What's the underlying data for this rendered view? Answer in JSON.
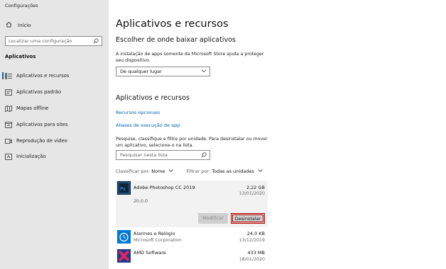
{
  "window": {
    "title": "Configurações"
  },
  "sidebar": {
    "home_label": "Início",
    "search_placeholder": "Localizar uma configuração",
    "section_label": "Aplicativos",
    "items": [
      {
        "label": "Aplicativos e recursos",
        "icon": "list-icon",
        "active": true
      },
      {
        "label": "Aplicativos padrão",
        "icon": "default-apps-icon"
      },
      {
        "label": "Mapas offline",
        "icon": "map-icon"
      },
      {
        "label": "Aplicativos para sites",
        "icon": "web-app-icon"
      },
      {
        "label": "Reprodução de vídeo",
        "icon": "video-icon"
      },
      {
        "label": "Inicialização",
        "icon": "startup-icon"
      }
    ]
  },
  "main": {
    "title": "Aplicativos e recursos",
    "install_section": {
      "heading": "Escolher de onde baixar aplicativos",
      "description": "A instalação de apps somente da Microsoft Store ajuda a proteger seu dispositivo.",
      "dropdown_value": "De qualquer lugar"
    },
    "apps_section": {
      "heading": "Aplicativos e recursos",
      "link_optional": "Recursos opcionais",
      "link_aliases": "Aliases de execução de app",
      "description": "Pesquise, classifique e filtre por unidade. Para desinstalar ou mover um aplicativo, selecione-o na lista.",
      "search_placeholder": "Pesquisar nesta lista",
      "sort_label": "Classificar por:",
      "sort_value": "Nome",
      "filter_label": "Filtrar por:",
      "filter_value": "Todas as unidades"
    },
    "apps": [
      {
        "name": "Adobe Photoshop CC 2019",
        "publisher": "",
        "size": "2,22 GB",
        "date": "13/01/2020",
        "version": "20.0.0",
        "icon": "photoshop-icon",
        "expanded": true
      },
      {
        "name": "Alarmes e Relógio",
        "publisher": "Microsoft Corporation",
        "size": "24,0 KB",
        "date": "13/12/2019",
        "icon": "alarm-clock-icon"
      },
      {
        "name": "AMD Software",
        "publisher": "",
        "size": "433 MB",
        "date": "18/01/2020",
        "icon": "amd-icon"
      }
    ],
    "buttons": {
      "modify": "Modificar",
      "uninstall": "Desinstalar"
    }
  },
  "colors": {
    "accent": "#0067c0",
    "link": "#0063b1",
    "sidebar_bg": "#e6e6e6",
    "highlight": "#c00000"
  }
}
